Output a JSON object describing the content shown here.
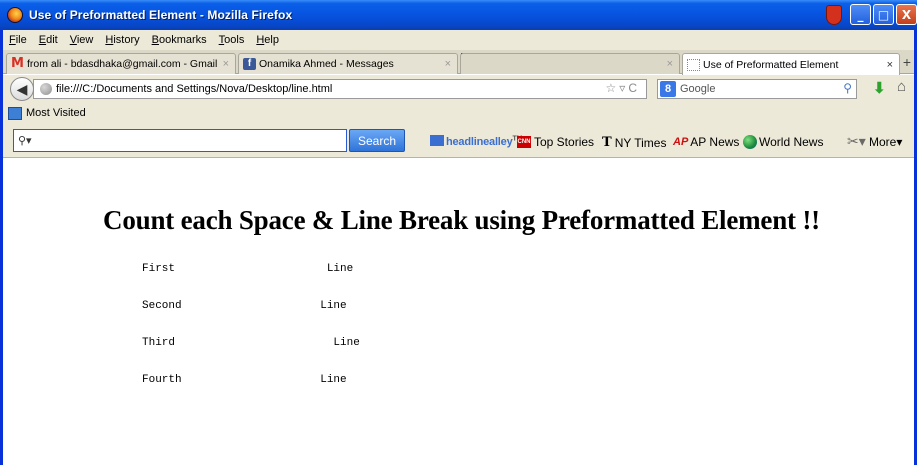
{
  "window": {
    "title": "Use of Preformatted Element - Mozilla Firefox",
    "controls": {
      "minimize": "_",
      "maximize": "□",
      "close": "X"
    }
  },
  "menu": [
    "File",
    "Edit",
    "View",
    "History",
    "Bookmarks",
    "Tools",
    "Help"
  ],
  "tabs": [
    {
      "label": "from ali - bdasdhaka@gmail.com - Gmail",
      "icon": "gmail-icon"
    },
    {
      "label": "Onamika Ahmed - Messages",
      "icon": "facebook-icon"
    },
    {
      "label": "Use of Preformatted Element",
      "icon": "blank-page-icon",
      "active": true
    }
  ],
  "nav": {
    "url": "file:///C:/Documents and Settings/Nova/Desktop/line.html",
    "search_placeholder": "Google"
  },
  "bookmarks": {
    "most_visited": "Most Visited"
  },
  "toolbar": {
    "search_value": "",
    "search_button": "Search",
    "headline_alley": "headlinealley",
    "links": [
      "Top Stories",
      "NY Times",
      "AP News",
      "World News"
    ],
    "more": "More"
  },
  "page": {
    "heading": "Count each Space & Line Break using Preformatted Element !!",
    "pre_lines": [
      "First                       Line",
      "Second                     Line",
      "Third                        Line",
      "Fourth                     Line"
    ]
  }
}
